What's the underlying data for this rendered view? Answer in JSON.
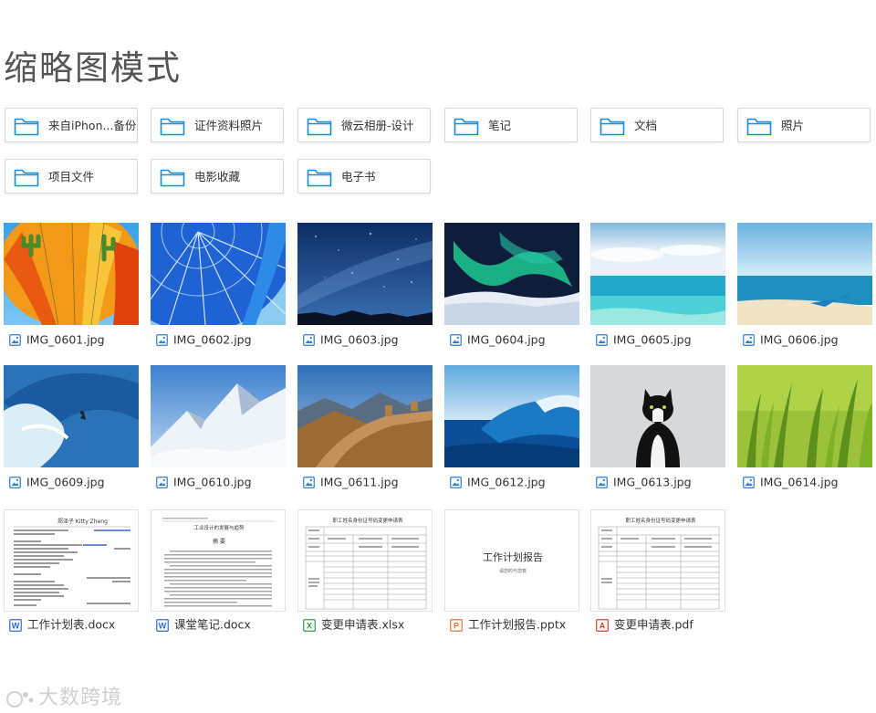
{
  "page": {
    "title": "缩略图模式"
  },
  "folders": [
    {
      "label": "来自iPhon...备份"
    },
    {
      "label": "证件资料照片"
    },
    {
      "label": "微云相册-设计"
    },
    {
      "label": "笔记"
    },
    {
      "label": "文档"
    },
    {
      "label": "照片"
    },
    {
      "label": "项目文件"
    },
    {
      "label": "电影收藏"
    },
    {
      "label": "电子书"
    }
  ],
  "images": [
    {
      "name": "IMG_0601.jpg",
      "subject": "hot-air-balloon"
    },
    {
      "name": "IMG_0602.jpg",
      "subject": "blue-balloon"
    },
    {
      "name": "IMG_0603.jpg",
      "subject": "night-sky"
    },
    {
      "name": "IMG_0604.jpg",
      "subject": "aurora"
    },
    {
      "name": "IMG_0605.jpg",
      "subject": "sea"
    },
    {
      "name": "IMG_0606.jpg",
      "subject": "beach-boat"
    },
    {
      "name": "IMG_0609.jpg",
      "subject": "surfer"
    },
    {
      "name": "IMG_0610.jpg",
      "subject": "snow-mountain"
    },
    {
      "name": "IMG_0611.jpg",
      "subject": "great-wall"
    },
    {
      "name": "IMG_0612.jpg",
      "subject": "wave"
    },
    {
      "name": "IMG_0613.jpg",
      "subject": "cat"
    },
    {
      "name": "IMG_0614.jpg",
      "subject": "grass"
    }
  ],
  "documents": [
    {
      "name": "工作计划表.docx",
      "type": "word",
      "icon_color": "#2b6fd6",
      "icon_letter": "W"
    },
    {
      "name": "课堂笔记.docx",
      "type": "word",
      "icon_color": "#2b6fd6",
      "icon_letter": "W"
    },
    {
      "name": "变更申请表.xlsx",
      "type": "excel",
      "icon_color": "#2e9e45",
      "icon_letter": "X"
    },
    {
      "name": "工作计划报告.pptx",
      "type": "powerpoint",
      "icon_color": "#e0753a",
      "icon_letter": "P"
    },
    {
      "name": "变更申请表.pdf",
      "type": "pdf",
      "icon_color": "#d63c2b",
      "icon_letter": "A"
    }
  ],
  "doc_previews": {
    "resume_name": "郑泽子 Kitty Zheng",
    "notes_title": "工业设计的发展与趋势",
    "notes_heading": "摘 要",
    "form_title": "职工姓名身份证号码变更申请表",
    "ppt_title": "工作计划报告",
    "ppt_subtitle": "请您的与您衰"
  },
  "watermark": "大数跨境",
  "colors": {
    "folder_icon": "#1a8be0",
    "border": "#d6d6d6"
  }
}
